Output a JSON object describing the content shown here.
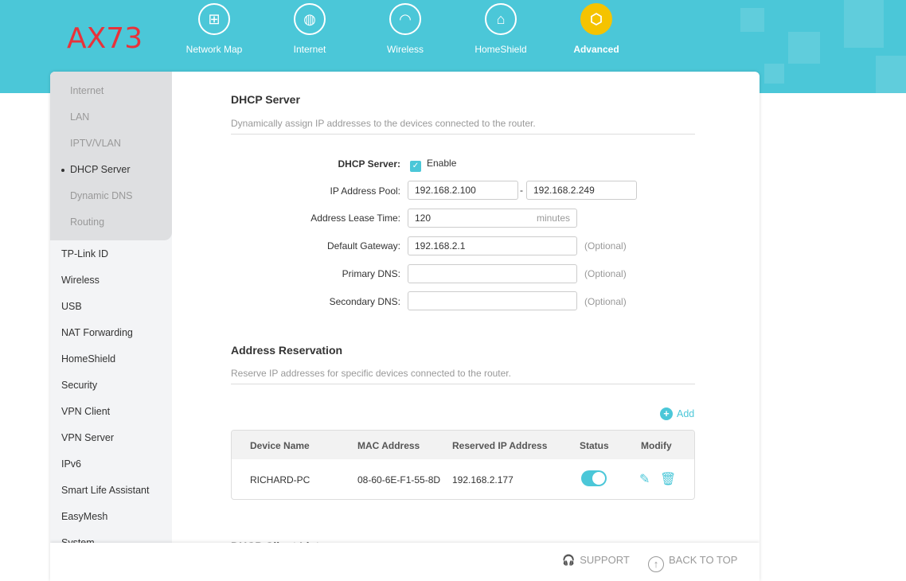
{
  "header": {
    "logo": "AX73",
    "nav": [
      {
        "label": "Network Map",
        "icon": "network-map-icon"
      },
      {
        "label": "Internet",
        "icon": "globe-icon"
      },
      {
        "label": "Wireless",
        "icon": "wifi-icon"
      },
      {
        "label": "HomeShield",
        "icon": "homeshield-icon"
      },
      {
        "label": "Advanced",
        "icon": "gear-icon",
        "active": true
      }
    ]
  },
  "sidebar": {
    "network_sub": [
      "Internet",
      "LAN",
      "IPTV/VLAN",
      "DHCP Server",
      "Dynamic DNS",
      "Routing"
    ],
    "active": "DHCP Server",
    "items": [
      "TP-Link ID",
      "Wireless",
      "USB",
      "NAT Forwarding",
      "HomeShield",
      "Security",
      "VPN Client",
      "VPN Server",
      "IPv6",
      "Smart Life Assistant",
      "EasyMesh",
      "System"
    ]
  },
  "dhcp": {
    "title": "DHCP Server",
    "desc": "Dynamically assign IP addresses to the devices connected to the router.",
    "server_label": "DHCP Server:",
    "enable_label": "Enable",
    "enabled": true,
    "pool_label": "IP Address Pool:",
    "pool_start": "192.168.2.100",
    "pool_sep": "-",
    "pool_end": "192.168.2.249",
    "lease_label": "Address Lease Time:",
    "lease": "120",
    "lease_unit": "minutes",
    "gateway_label": "Default Gateway:",
    "gateway": "192.168.2.1",
    "primary_label": "Primary DNS:",
    "primary": "",
    "secondary_label": "Secondary DNS:",
    "secondary": "",
    "optional": "(Optional)"
  },
  "reservation": {
    "title": "Address Reservation",
    "desc": "Reserve IP addresses for specific devices connected to the router.",
    "add_label": "Add",
    "columns": [
      "Device Name",
      "MAC Address",
      "Reserved IP Address",
      "Status",
      "Modify"
    ],
    "rows": [
      {
        "name": "RICHARD-PC",
        "mac": "08-60-6E-F1-55-8D",
        "ip": "192.168.2.177",
        "status": true
      }
    ]
  },
  "next_section": "DHCP Client List",
  "footer": {
    "support": "SUPPORT",
    "back_to_top": "BACK TO TOP"
  }
}
